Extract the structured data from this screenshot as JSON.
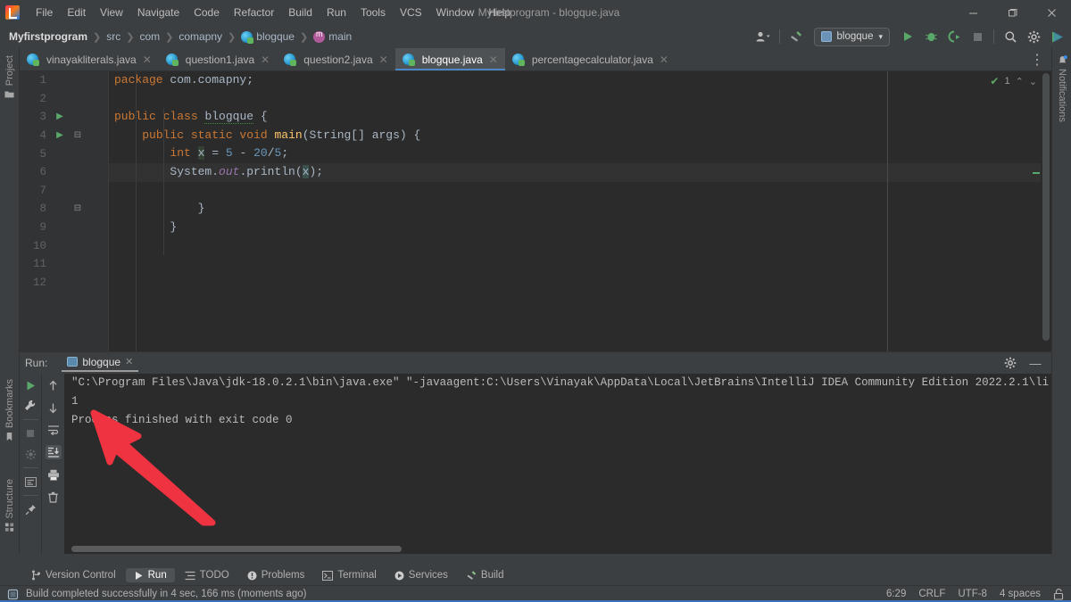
{
  "window": {
    "title": "Myfirstprogram - blogque.java",
    "minimize_label": "—",
    "maximize_label": "❐",
    "close_label": "✕"
  },
  "menubar": {
    "logo_name": "intellij-idea-logo",
    "items": [
      "File",
      "Edit",
      "View",
      "Navigate",
      "Code",
      "Refactor",
      "Build",
      "Run",
      "Tools",
      "VCS",
      "Window",
      "Help"
    ]
  },
  "breadcrumb": {
    "items": [
      {
        "label": "Myfirstprogram",
        "icon": "none",
        "root": true
      },
      {
        "label": "src",
        "icon": "none"
      },
      {
        "label": "com",
        "icon": "none"
      },
      {
        "label": "comapny",
        "icon": "none"
      },
      {
        "label": "blogque",
        "icon": "class-icon"
      },
      {
        "label": "main",
        "icon": "method-icon"
      }
    ],
    "separator": "❯"
  },
  "toolbar": {
    "account_icon": "user-account-icon",
    "account_caret": "▾",
    "build_icon": "build-hammer-icon",
    "run_config_name": "blogque",
    "run_config_caret": "▾",
    "run_icon": "run-icon",
    "debug_icon": "debug-icon",
    "run_coverage_icon": "run-with-coverage-icon",
    "stop_icon": "stop-icon",
    "search_icon": "search-everywhere-icon",
    "settings_icon": "settings-gear-icon",
    "updates_icon": "updates-icon"
  },
  "left_strip": {
    "items": [
      {
        "label": "Project",
        "icon": "project-folder-icon"
      },
      {
        "label": "Bookmarks",
        "icon": "bookmark-icon"
      },
      {
        "label": "Structure",
        "icon": "structure-icon"
      }
    ]
  },
  "right_strip": {
    "items": [
      {
        "label": "Notifications",
        "icon": "notifications-bell-icon"
      }
    ]
  },
  "editor_tabs": {
    "tabs": [
      {
        "label": "vinayakliterals.java",
        "active": false,
        "close": "✕"
      },
      {
        "label": "question1.java",
        "active": false,
        "close": "✕"
      },
      {
        "label": "question2.java",
        "active": false,
        "close": "✕"
      },
      {
        "label": "blogque.java",
        "active": true,
        "close": "✕"
      },
      {
        "label": "percentagecalculator.java",
        "active": false,
        "close": "✕"
      }
    ],
    "more_icon": "more-options-icon",
    "more_label": "⋮"
  },
  "editor": {
    "inspection_count": "1",
    "inspection_icon": "inspection-ok-icon",
    "prev_problem_icon": "chevron-up-icon",
    "next_problem_icon": "chevron-down-icon",
    "prev_label": "⌃",
    "next_label": "⌄",
    "line_numbers": [
      "1",
      "2",
      "3",
      "4",
      "5",
      "6",
      "7",
      "8",
      "9",
      "10",
      "11",
      "12"
    ],
    "run_markers": {
      "3": "▶",
      "4": "▶"
    },
    "fold_markers": {
      "4": "⊟",
      "8": "⊟"
    },
    "current_line": 6,
    "lines": [
      {
        "n": 1,
        "text": "package com.comapny;"
      },
      {
        "n": 2,
        "text": ""
      },
      {
        "n": 3,
        "text": "public class blogque {"
      },
      {
        "n": 4,
        "text": "    public static void main(String[] args) {"
      },
      {
        "n": 5,
        "text": "        int x = 5 - 20/5;"
      },
      {
        "n": 6,
        "text": "        System.out.println(x);"
      },
      {
        "n": 7,
        "text": ""
      },
      {
        "n": 8,
        "text": "            }"
      },
      {
        "n": 9,
        "text": "        }"
      },
      {
        "n": 10,
        "text": ""
      },
      {
        "n": 11,
        "text": ""
      },
      {
        "n": 12,
        "text": ""
      }
    ]
  },
  "run_window": {
    "label": "Run:",
    "tab_label": "blogque",
    "tab_close": "✕",
    "tab_icon": "console-icon",
    "settings_icon": "settings-gear-icon",
    "minimize_icon": "minimize-icon",
    "minimize_label": "—",
    "gutter_left": [
      {
        "icon": "rerun-icon",
        "glyph": "▶"
      },
      {
        "icon": "edit-configuration-wrench-icon",
        "glyph": "🔧"
      },
      {
        "icon": "stop-icon",
        "glyph": "■"
      },
      {
        "icon": "dump-threads-icon",
        "glyph": "✻"
      },
      {
        "icon": "console-view-icon",
        "glyph": "▤"
      },
      {
        "icon": "pin-tab-icon",
        "glyph": "📌"
      }
    ],
    "gutter_right": [
      {
        "icon": "up-arrow-icon",
        "glyph": "↑"
      },
      {
        "icon": "down-arrow-icon",
        "glyph": "↓"
      },
      {
        "icon": "soft-wrap-icon",
        "glyph": "⇥"
      },
      {
        "icon": "scroll-to-end-icon",
        "glyph": "⤓",
        "selected": true
      },
      {
        "icon": "print-icon",
        "glyph": "🖶"
      },
      {
        "icon": "clear-all-icon",
        "glyph": "🗑"
      }
    ],
    "console_lines": [
      "\"C:\\Program Files\\Java\\jdk-18.0.2.1\\bin\\java.exe\" \"-javaagent:C:\\Users\\Vinayak\\AppData\\Local\\JetBrains\\IntelliJ IDEA Community Edition 2022.2.1\\li",
      "1",
      "",
      "Process finished with exit code 0"
    ]
  },
  "bottom_bar": {
    "items": [
      {
        "label": "Version Control",
        "icon": "version-control-icon",
        "glyph": "⑂",
        "active": false
      },
      {
        "label": "Run",
        "icon": "run-icon",
        "glyph": "▶",
        "active": true
      },
      {
        "label": "TODO",
        "icon": "todo-list-icon",
        "glyph": "☰",
        "active": false
      },
      {
        "label": "Problems",
        "icon": "problems-icon",
        "glyph": "❶",
        "active": false
      },
      {
        "label": "Terminal",
        "icon": "terminal-icon",
        "glyph": "▣",
        "active": false
      },
      {
        "label": "Services",
        "icon": "services-icon",
        "glyph": "◉",
        "active": false
      },
      {
        "label": "Build",
        "icon": "build-hammer-icon",
        "glyph": "🔨",
        "active": false
      }
    ]
  },
  "status_bar": {
    "build_icon": "build-status-icon",
    "message": "Build completed successfully in 4 sec, 166 ms (moments ago)",
    "caret_position": "6:29",
    "line_separator": "CRLF",
    "encoding": "UTF-8",
    "indent": "4 spaces",
    "lock_icon": "read-write-lock-icon"
  },
  "annotation": {
    "arrow_color": "#ef3340",
    "arrow_name": "red-pointer-arrow",
    "points_to": "console output value 1"
  },
  "colors": {
    "background": "#3c3f41",
    "editor_bg": "#2b2b2b",
    "accent_blue": "#4a88c7",
    "keyword_orange": "#cc7832",
    "number_blue": "#6897bb",
    "field_purple": "#9876aa",
    "text_default": "#a9b7c6",
    "run_green": "#59a869"
  }
}
